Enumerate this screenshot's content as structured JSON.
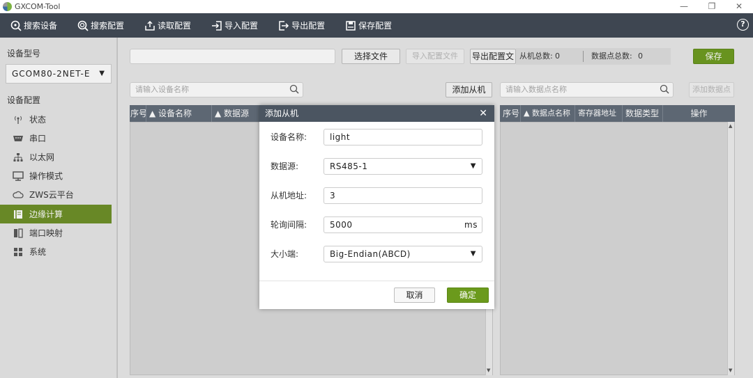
{
  "window": {
    "title": "GXCOM-Tool",
    "controls": {
      "minimize": "—",
      "restore": "❐",
      "close": "✕"
    }
  },
  "toolbar": {
    "buttons": [
      {
        "label": "搜索设备",
        "icon": "search-device-icon"
      },
      {
        "label": "搜索配置",
        "icon": "search-config-icon"
      },
      {
        "label": "读取配置",
        "icon": "upload-icon"
      },
      {
        "label": "导入配置",
        "icon": "import-icon"
      },
      {
        "label": "导出配置",
        "icon": "export-icon"
      },
      {
        "label": "保存配置",
        "icon": "save-icon"
      }
    ],
    "help": "?"
  },
  "sidebar": {
    "model_heading": "设备型号",
    "model_value": "GCOM80-2NET-E",
    "config_heading": "设备配置",
    "items": [
      {
        "label": "状态",
        "icon": "antenna-icon"
      },
      {
        "label": "串口",
        "icon": "serial-port-icon"
      },
      {
        "label": "以太网",
        "icon": "network-icon"
      },
      {
        "label": "操作模式",
        "icon": "monitor-icon"
      },
      {
        "label": "ZWS云平台",
        "icon": "cloud-icon"
      },
      {
        "label": "边缘计算",
        "icon": "edge-compute-icon"
      },
      {
        "label": "端口映射",
        "icon": "port-map-icon"
      },
      {
        "label": "系统",
        "icon": "grid-icon"
      }
    ],
    "active_index": 5
  },
  "main": {
    "file_path": "",
    "select_file": "选择文件",
    "import_config": "导入配置文件",
    "export_config": "导出配置文",
    "slave_total_label": "从机总数:",
    "slave_total": "0",
    "point_total_label": "数据点总数:",
    "point_total": "0",
    "save": "保存",
    "device_search_placeholder": "请输入设备名称",
    "add_slave": "添加从机",
    "point_search_placeholder": "请输入数据点名称",
    "add_point": "添加数据点",
    "device_table": {
      "columns": [
        "序号",
        "设备名称",
        "数据源"
      ]
    },
    "point_table": {
      "columns": [
        "序号",
        "数据点名称",
        "寄存器地址",
        "数据类型",
        "操作"
      ]
    }
  },
  "dialog": {
    "title": "添加从机",
    "close": "✕",
    "fields": {
      "name_label": "设备名称:",
      "name_value": "light",
      "source_label": "数据源:",
      "source_value": "RS485-1",
      "address_label": "从机地址:",
      "address_value": "3",
      "interval_label": "轮询间隔:",
      "interval_value": "5000",
      "interval_unit": "ms",
      "endian_label": "大小端:",
      "endian_value": "Big-Endian(ABCD)"
    },
    "cancel": "取消",
    "confirm": "确定"
  },
  "colors": {
    "toolbar_bg": "#3e4651",
    "accent_green": "#6b8e23",
    "table_header": "#5f6a77",
    "dialog_title": "#4b5561"
  }
}
